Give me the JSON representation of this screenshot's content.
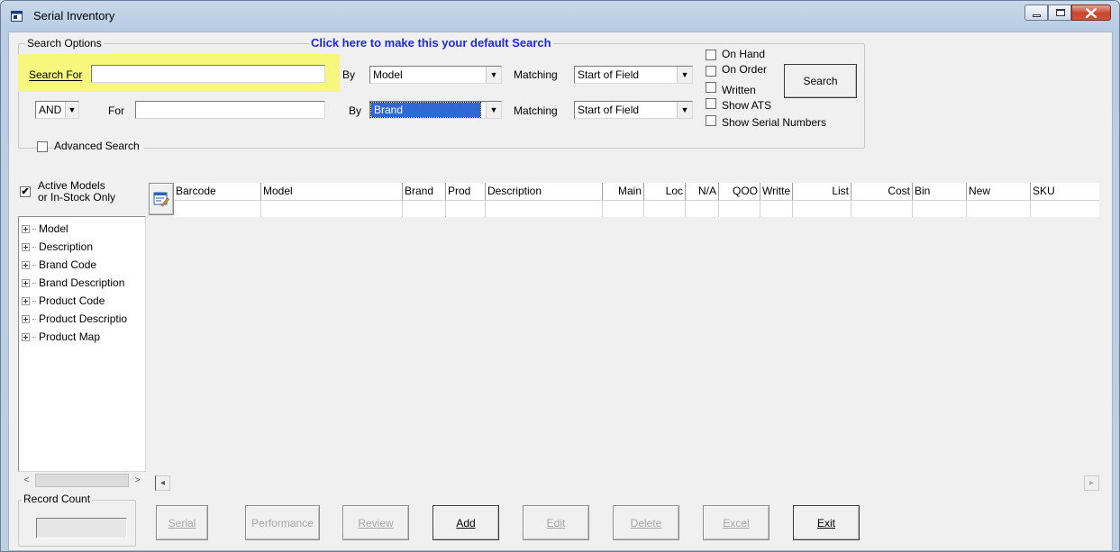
{
  "window": {
    "title": "Serial Inventory"
  },
  "search_options": {
    "legend": "Search Options",
    "default_link": "Click here to make this your default Search",
    "row1": {
      "label": "Search For",
      "value": "",
      "by_label": "By",
      "by_value": "Model",
      "matching_label": "Matching",
      "matching_value": "Start of Field"
    },
    "row2": {
      "operator": "AND",
      "label": "For",
      "value": "",
      "by_label": "By",
      "by_value": "Brand",
      "matching_label": "Matching",
      "matching_value": "Start of Field"
    },
    "checkboxes": [
      {
        "label": "On Hand",
        "checked": false
      },
      {
        "label": "On Order",
        "checked": false
      },
      {
        "label": "Written",
        "checked": false
      },
      {
        "label": "Show ATS",
        "checked": false
      },
      {
        "label": "Show Serial Numbers",
        "checked": false
      }
    ],
    "search_button": "Search",
    "advanced_search": {
      "label": "Advanced Search",
      "checked": false
    }
  },
  "filter": {
    "active_models_line1": "Active Models",
    "active_models_line2": "or In-Stock Only",
    "checked": true,
    "check_glyph": "✔"
  },
  "tree": {
    "items": [
      "Model",
      "Description",
      "Brand Code",
      "Brand Description",
      "Product Code",
      "Product Descriptio",
      "Product Map"
    ]
  },
  "grid": {
    "columns": [
      {
        "label": "Barcode"
      },
      {
        "label": "Model"
      },
      {
        "label": "Brand"
      },
      {
        "label": "Prod"
      },
      {
        "label": "Description"
      },
      {
        "label": "Main"
      },
      {
        "label": "Loc"
      },
      {
        "label": "N/A"
      },
      {
        "label": "QOO"
      },
      {
        "label": "Writte"
      },
      {
        "label": "List"
      },
      {
        "label": "Cost"
      },
      {
        "label": "Bin"
      },
      {
        "label": "New"
      },
      {
        "label": "SKU"
      }
    ]
  },
  "record_count": {
    "legend": "Record Count",
    "value": ""
  },
  "buttons": [
    {
      "label": "Serial",
      "enabled": false
    },
    {
      "label": "Performance",
      "enabled": false
    },
    {
      "label": "Review",
      "enabled": false
    },
    {
      "label": "Add",
      "enabled": true
    },
    {
      "label": "Edit",
      "enabled": false
    },
    {
      "label": "Delete",
      "enabled": false
    },
    {
      "label": "Excel",
      "enabled": false
    },
    {
      "label": "Exit",
      "enabled": true
    }
  ],
  "icons": {
    "app": "window-app-icon",
    "minimize": "minimize-icon",
    "maximize": "maximize-icon",
    "close": "close-icon",
    "dropdown": "chevron-down-icon",
    "grid_settings": "grid-settings-icon",
    "scroll_left": "scroll-left-icon",
    "scroll_right": "scroll-right-icon"
  },
  "colors": {
    "highlight": "#f6f77c",
    "link": "#1f2ad8",
    "selection": "#3168d5",
    "close_button": "#c8452e"
  }
}
